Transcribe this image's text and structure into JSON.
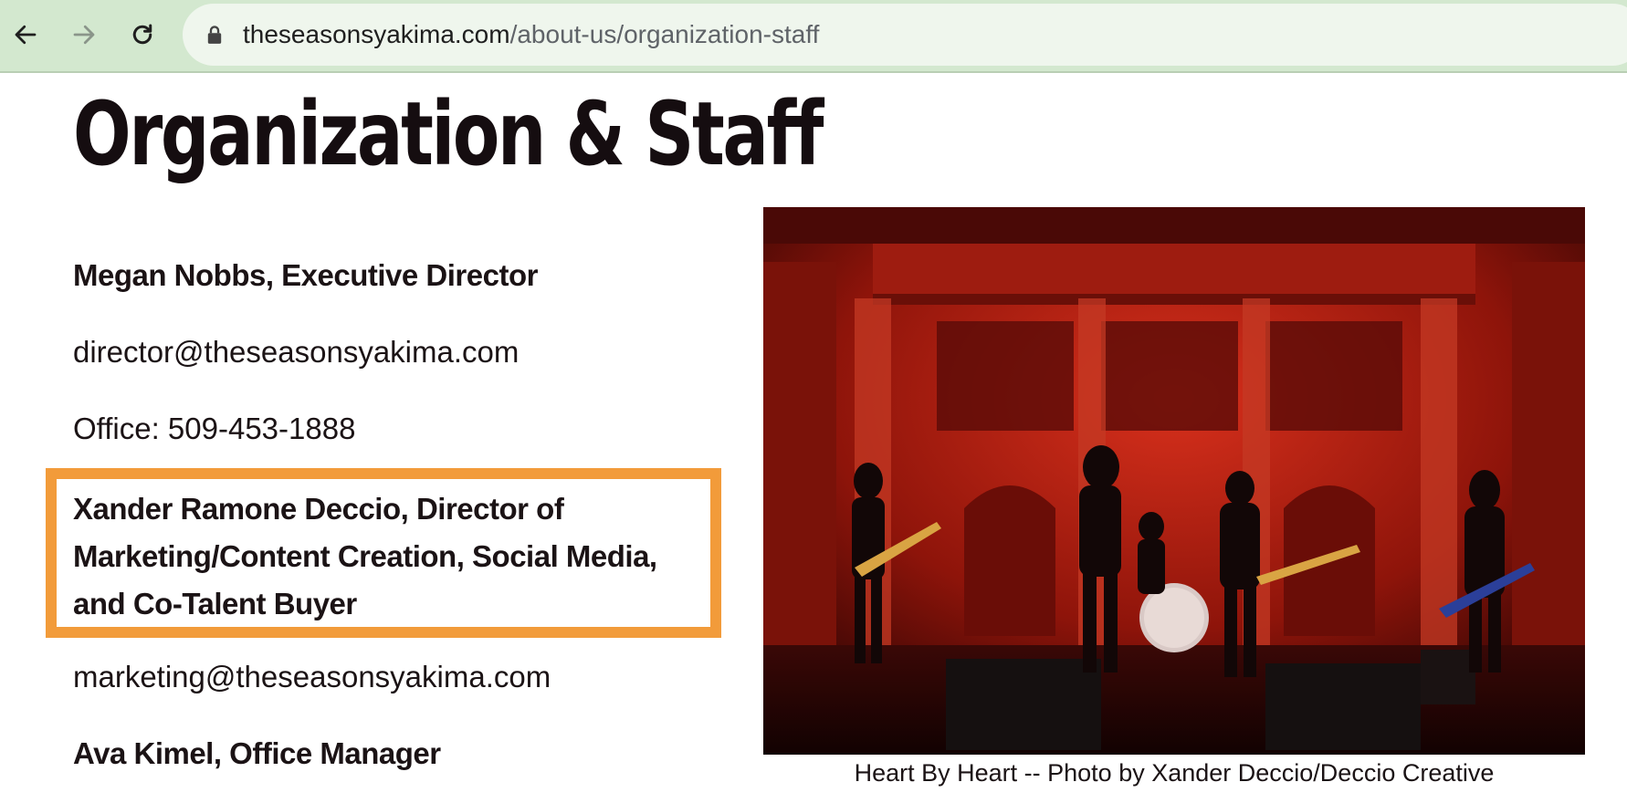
{
  "browser": {
    "url_domain": "theseasonsyakima.com",
    "url_path": "/about-us/organization-staff"
  },
  "page": {
    "title": "Organization & Staff"
  },
  "staff": [
    {
      "name": "Megan Nobbs, Executive Director",
      "email": "director@theseasonsyakima.com",
      "office": "Office: 509-453-1888"
    },
    {
      "name": "Xander Ramone Deccio, Director of Marketing/Content Creation, Social Media, and Co-Talent Buyer",
      "email": "marketing@theseasonsyakima.com"
    },
    {
      "name": "Ava Kimel, Office Manager"
    }
  ],
  "photo": {
    "caption": "Heart By Heart -- Photo by Xander Deccio/Deccio Creative"
  },
  "colors": {
    "toolbar": "#d3e8cf",
    "highlight": "#f29b3a",
    "stage_red": "#b0160c"
  }
}
